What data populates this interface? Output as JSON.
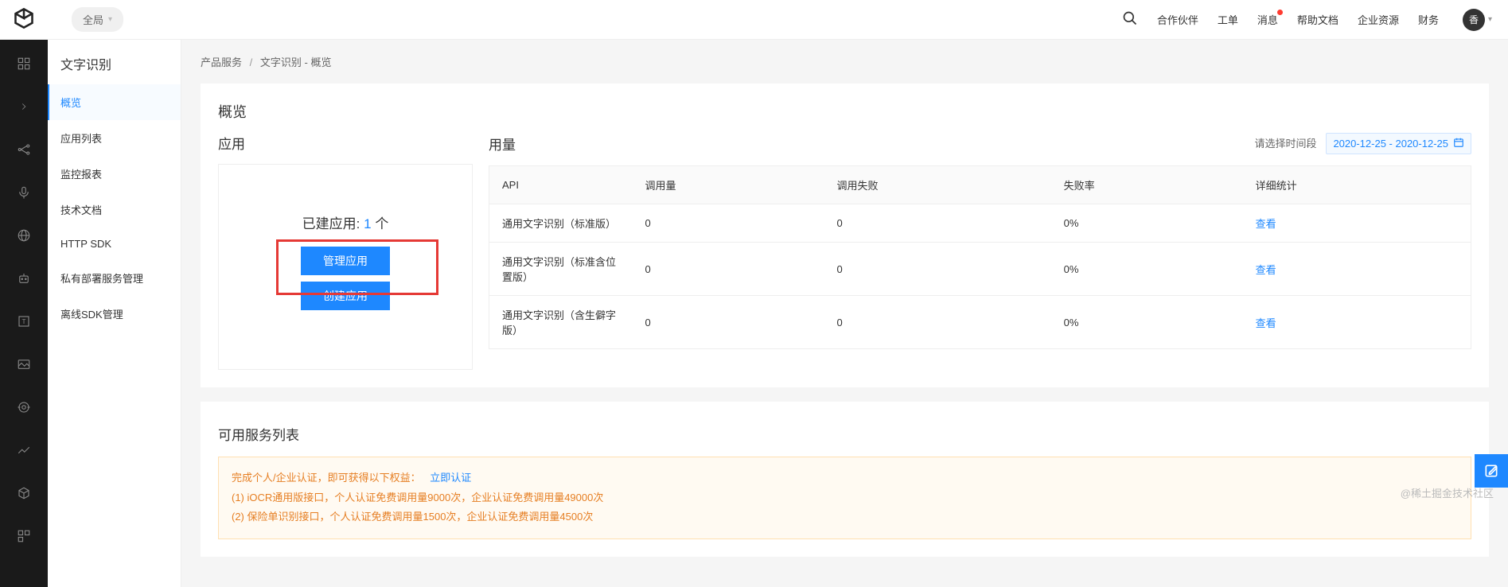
{
  "header": {
    "global_label": "全局",
    "links": {
      "partner": "合作伙伴",
      "ticket": "工单",
      "message": "消息",
      "help_doc": "帮助文档",
      "enterprise_res": "企业资源",
      "finance": "财务"
    },
    "avatar_char": "香"
  },
  "sidebar": {
    "title": "文字识别",
    "items": [
      {
        "label": "概览",
        "active": true
      },
      {
        "label": "应用列表",
        "active": false
      },
      {
        "label": "监控报表",
        "active": false
      },
      {
        "label": "技术文档",
        "active": false
      },
      {
        "label": "HTTP SDK",
        "active": false
      },
      {
        "label": "私有部署服务管理",
        "active": false
      },
      {
        "label": "离线SDK管理",
        "active": false
      }
    ]
  },
  "breadcrumb": {
    "root": "产品服务",
    "current": "文字识别 - 概览"
  },
  "overview": {
    "title": "概览",
    "app_section_title": "应用",
    "usage_section_title": "用量",
    "date_label": "请选择时间段",
    "date_value": "2020-12-25 - 2020-12-25",
    "app_count_prefix": "已建应用: ",
    "app_count_num": "1",
    "app_count_suffix": " 个",
    "manage_btn": "管理应用",
    "create_btn": "创建应用"
  },
  "usage_table": {
    "headers": {
      "api": "API",
      "calls": "调用量",
      "fails": "调用失败",
      "fail_rate": "失败率",
      "detail": "详细统计"
    },
    "rows": [
      {
        "api": "通用文字识别（标准版）",
        "calls": "0",
        "fails": "0",
        "fail_rate": "0%",
        "detail": "查看"
      },
      {
        "api": "通用文字识别（标准含位置版）",
        "calls": "0",
        "fails": "0",
        "fail_rate": "0%",
        "detail": "查看"
      },
      {
        "api": "通用文字识别（含生僻字版）",
        "calls": "0",
        "fails": "0",
        "fail_rate": "0%",
        "detail": "查看"
      }
    ]
  },
  "service_list": {
    "title": "可用服务列表",
    "banner_line1": "完成个人/企业认证，即可获得以下权益：",
    "banner_link": "立即认证",
    "banner_line2": "(1) iOCR通用版接口，个人认证免费调用量9000次，企业认证免费调用量49000次",
    "banner_line3": "(2) 保险单识别接口，个人认证免费调用量1500次，企业认证免费调用量4500次"
  },
  "watermark": "@稀土掘金技术社区"
}
